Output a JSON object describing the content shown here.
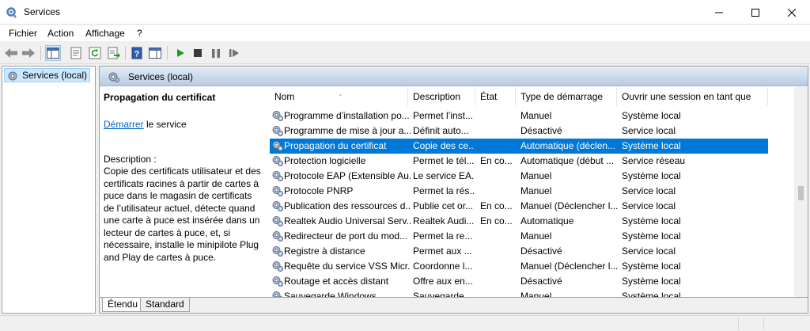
{
  "window": {
    "title": "Services"
  },
  "menu": [
    "Fichier",
    "Action",
    "Affichage",
    "?"
  ],
  "toolbar": {
    "icons": [
      "back-arrow-icon",
      "forward-arrow-icon",
      "console-tree-icon",
      "properties-icon",
      "refresh-icon",
      "export-icon",
      "help-icon",
      "show-hide-pane-icon",
      "play-icon",
      "stop-icon",
      "pause-icon",
      "restart-icon"
    ]
  },
  "tree": {
    "root_label": "Services (local)"
  },
  "main": {
    "header_title": "Services (local)",
    "selected_service": "Propagation du certificat",
    "action_link": "Démarrer",
    "action_suffix": " le service",
    "description_label": "Description :",
    "description_text": "Copie des certificats utilisateur et des certificats racines à partir de cartes à puce dans le magasin de certificats de l’utilisateur actuel, détecte quand une carte à puce est insérée dans un lecteur de cartes à puce, et, si nécessaire, installe le minipilote Plug and Play de cartes à puce."
  },
  "columns": [
    "Nom",
    "Description",
    "État",
    "Type de démarrage",
    "Ouvrir une session en tant que"
  ],
  "rows": [
    {
      "name": "Programme d’installation po...",
      "description": "Permet l’inst...",
      "state": "",
      "startup": "Manuel",
      "logon": "Système local",
      "selected": false
    },
    {
      "name": "Programme de mise à jour a...",
      "description": "Définit auto...",
      "state": "",
      "startup": "Désactivé",
      "logon": "Service local",
      "selected": false
    },
    {
      "name": "Propagation du certificat",
      "description": "Copie des ce...",
      "state": "",
      "startup": "Automatique (déclen...",
      "logon": "Système local",
      "selected": true
    },
    {
      "name": "Protection logicielle",
      "description": "Permet le tél...",
      "state": "En co...",
      "startup": "Automatique (début ...",
      "logon": "Service réseau",
      "selected": false
    },
    {
      "name": "Protocole EAP (Extensible Au...",
      "description": "Le service EA...",
      "state": "",
      "startup": "Manuel",
      "logon": "Système local",
      "selected": false
    },
    {
      "name": "Protocole PNRP",
      "description": "Permet la rés...",
      "state": "",
      "startup": "Manuel",
      "logon": "Service local",
      "selected": false
    },
    {
      "name": "Publication des ressources d...",
      "description": "Publie cet or...",
      "state": "En co...",
      "startup": "Manuel (Déclencher l...",
      "logon": "Service local",
      "selected": false
    },
    {
      "name": "Realtek Audio Universal Serv...",
      "description": "Realtek Audi...",
      "state": "En co...",
      "startup": "Automatique",
      "logon": "Système local",
      "selected": false
    },
    {
      "name": "Redirecteur de port du mod...",
      "description": "Permet la re...",
      "state": "",
      "startup": "Manuel",
      "logon": "Système local",
      "selected": false
    },
    {
      "name": "Registre à distance",
      "description": "Permet aux ...",
      "state": "",
      "startup": "Désactivé",
      "logon": "Service local",
      "selected": false
    },
    {
      "name": "Requête du service VSS Micr...",
      "description": "Coordonne l...",
      "state": "",
      "startup": "Manuel (Déclencher l...",
      "logon": "Système local",
      "selected": false
    },
    {
      "name": "Routage et accès distant",
      "description": "Offre aux en...",
      "state": "",
      "startup": "Désactivé",
      "logon": "Système local",
      "selected": false
    },
    {
      "name": "Sauvegarde Windows",
      "description": "Sauvegarde ...",
      "state": "",
      "startup": "Manuel",
      "logon": "Système local",
      "selected": false
    }
  ],
  "tabs": [
    "Étendu",
    "Standard"
  ],
  "colors": {
    "selection": "#0078d7",
    "link": "#0066cc",
    "play": "#1a9c1a"
  }
}
